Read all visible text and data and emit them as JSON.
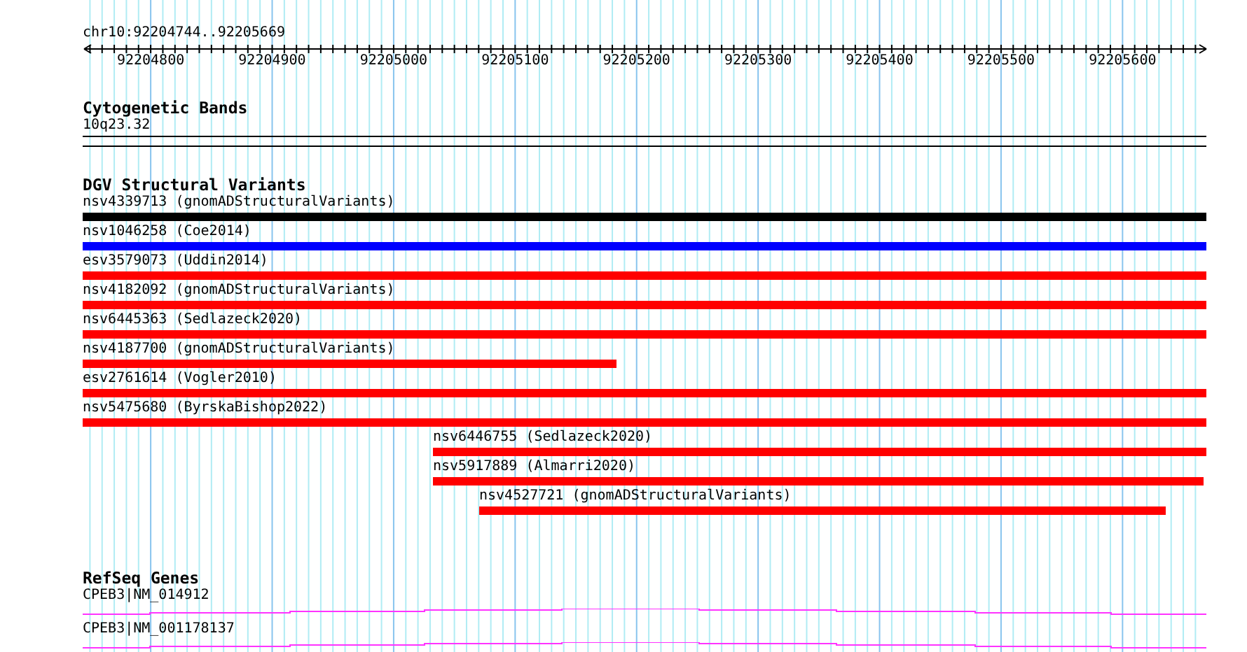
{
  "ruler": {
    "location": "chr10:92204744..92205669",
    "tick_labels": [
      "92204800",
      "92204900",
      "92205000",
      "92205100",
      "92205200",
      "92205300",
      "92205400",
      "92205500",
      "92205600"
    ]
  },
  "cytogenetic_bands": {
    "title": "Cytogenetic Bands",
    "band": "10q23.32"
  },
  "dgv": {
    "title": "DGV Structural Variants",
    "variants": [
      {
        "label": "nsv4339713 (gnomADStructuralVariants)",
        "color": "#000000"
      },
      {
        "label": "nsv1046258 (Coe2014)",
        "color": "#0000ff"
      },
      {
        "label": "esv3579073 (Uddin2014)",
        "color": "#ff0000"
      },
      {
        "label": "nsv4182092 (gnomADStructuralVariants)",
        "color": "#ff0000"
      },
      {
        "label": "nsv6445363 (Sedlazeck2020)",
        "color": "#ff0000"
      },
      {
        "label": "nsv4187700 (gnomADStructuralVariants)",
        "color": "#ff0000"
      },
      {
        "label": "esv2761614 (Vogler2010)",
        "color": "#ff0000"
      },
      {
        "label": "nsv5475680 (ByrskaBishop2022)",
        "color": "#ff0000"
      },
      {
        "label": "nsv6446755 (Sedlazeck2020)",
        "color": "#ff0000"
      },
      {
        "label": "nsv5917889 (Almarri2020)",
        "color": "#ff0000"
      },
      {
        "label": "nsv4527721 (gnomADStructuralVariants)",
        "color": "#ff0000"
      }
    ]
  },
  "refseq": {
    "title": "RefSeq Genes",
    "genes": [
      {
        "label": "CPEB3|NM_014912"
      },
      {
        "label": "CPEB3|NM_001178137"
      }
    ]
  }
}
